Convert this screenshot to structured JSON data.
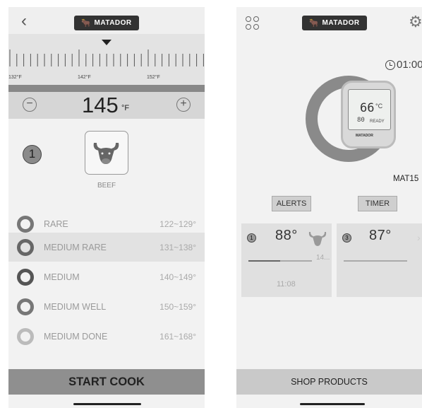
{
  "left_screen": {
    "brand": "MATADOR",
    "ruler_labels": [
      "132°F",
      "142°F",
      "152°F"
    ],
    "temperature": {
      "value": "145",
      "unit": "°F",
      "minus": "−",
      "plus": "+"
    },
    "probe_number": "1",
    "meat": {
      "label": "BEEF",
      "icon": "bull-head-icon"
    },
    "doneness": [
      {
        "name": "RARE",
        "range": "122~129°",
        "ring_color": "#777777",
        "selected": false
      },
      {
        "name": "MEDIUM RARE",
        "range": "131~138°",
        "ring_color": "#666666",
        "selected": true
      },
      {
        "name": "MEDIUM",
        "range": "140~149°",
        "ring_color": "#555555",
        "selected": false
      },
      {
        "name": "MEDIUM WELL",
        "range": "150~159°",
        "ring_color": "#777777",
        "selected": false
      },
      {
        "name": "MEDIUM DONE",
        "range": "161~168°",
        "ring_color": "#bbbbbb",
        "selected": false
      }
    ],
    "start_label": "START COOK"
  },
  "right_screen": {
    "brand": "MATADOR",
    "timer": "01:00",
    "device": {
      "temp": "66",
      "temp_unit": "°C",
      "sub": "80",
      "status": "READY",
      "brand": "MATADOR",
      "ring_progress": 1.0
    },
    "device_name": "MAT15",
    "alerts_label": "ALERTS",
    "timer_label": "TIMER",
    "probes": [
      {
        "num": "1",
        "temp": "88°",
        "target": "14...",
        "time": "11:08",
        "progress": 0.5,
        "icon": "bull-head-icon"
      },
      {
        "num": "3",
        "temp": "87°",
        "target": "",
        "time": "",
        "progress": 0,
        "icon": ""
      }
    ],
    "chevron": "›",
    "shop_label": "SHOP PRODUCTS"
  }
}
